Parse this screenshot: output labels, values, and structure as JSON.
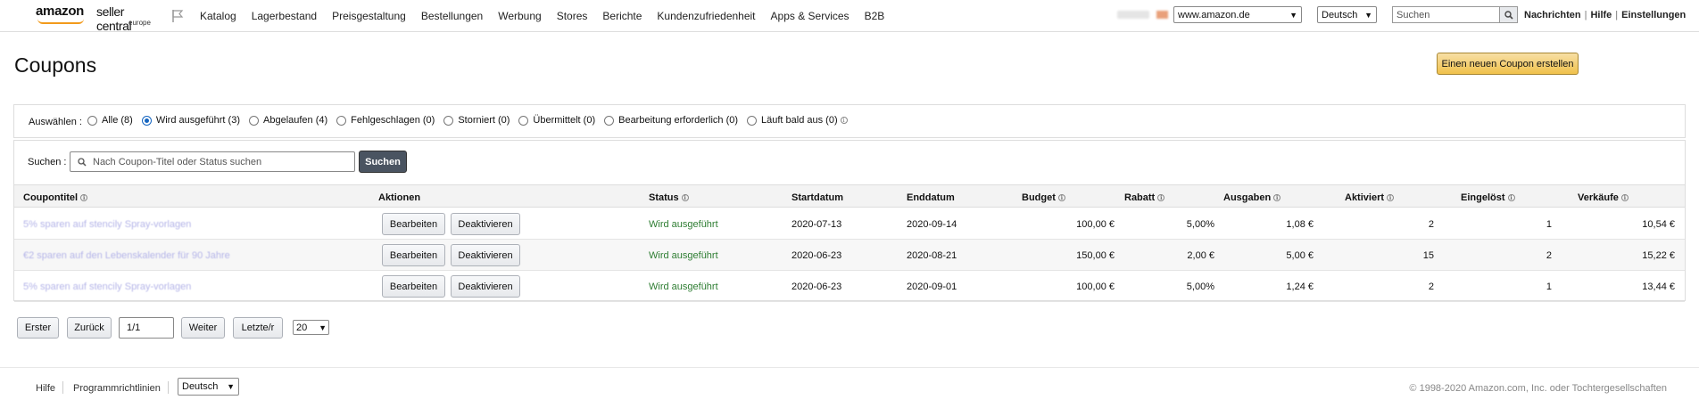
{
  "header": {
    "logo_amazon": "amazon",
    "logo_product": "seller central",
    "logo_region": "europe",
    "nav": [
      "Katalog",
      "Lagerbestand",
      "Preisgestaltung",
      "Bestellungen",
      "Werbung",
      "Stores",
      "Berichte",
      "Kundenzufriedenheit",
      "Apps & Services",
      "B2B"
    ],
    "marketplace": "www.amazon.de",
    "language": "Deutsch",
    "search_placeholder": "Suchen",
    "links": [
      "Nachrichten",
      "Hilfe",
      "Einstellungen"
    ]
  },
  "page": {
    "title": "Coupons",
    "create_button": "Einen neuen Coupon erstellen"
  },
  "filter": {
    "label": "Auswählen :",
    "options": [
      {
        "label": "Alle (8)",
        "selected": false
      },
      {
        "label": "Wird ausgeführt (3)",
        "selected": true
      },
      {
        "label": "Abgelaufen (4)",
        "selected": false
      },
      {
        "label": "Fehlgeschlagen (0)",
        "selected": false
      },
      {
        "label": "Storniert (0)",
        "selected": false
      },
      {
        "label": "Übermittelt (0)",
        "selected": false
      },
      {
        "label": "Bearbeitung erforderlich (0)",
        "selected": false
      },
      {
        "label": "Läuft bald aus (0)",
        "selected": false,
        "info": true
      }
    ]
  },
  "search": {
    "label": "Suchen :",
    "placeholder": "Nach Coupon-Titel oder Status suchen",
    "button": "Suchen"
  },
  "table": {
    "columns": [
      "Coupontitel",
      "Aktionen",
      "Status",
      "Startdatum",
      "Enddatum",
      "Budget",
      "Rabatt",
      "Ausgaben",
      "Aktiviert",
      "Eingelöst",
      "Verkäufe"
    ],
    "edit_label": "Bearbeiten",
    "deactivate_label": "Deaktivieren",
    "rows": [
      {
        "title": "5% sparen auf stencily Spray-vorlagen",
        "status": "Wird ausgeführt",
        "start": "2020-07-13",
        "end": "2020-09-14",
        "budget": "100,00 €",
        "rabatt": "5,00%",
        "ausgaben": "1,08 €",
        "aktiviert": "2",
        "eingeloest": "1",
        "verkaeufe": "10,54 €"
      },
      {
        "title": "€2 sparen auf den Lebenskalender für 90 Jahre",
        "status": "Wird ausgeführt",
        "start": "2020-06-23",
        "end": "2020-08-21",
        "budget": "150,00 €",
        "rabatt": "2,00 €",
        "ausgaben": "5,00 €",
        "aktiviert": "15",
        "eingeloest": "2",
        "verkaeufe": "15,22 €"
      },
      {
        "title": "5% sparen auf stencily Spray-vorlagen",
        "status": "Wird ausgeführt",
        "start": "2020-06-23",
        "end": "2020-09-01",
        "budget": "100,00 €",
        "rabatt": "5,00%",
        "ausgaben": "1,24 €",
        "aktiviert": "2",
        "eingeloest": "1",
        "verkaeufe": "13,44 €"
      }
    ]
  },
  "pager": {
    "first": "Erster",
    "prev": "Zurück",
    "page": "1/1",
    "next": "Weiter",
    "last": "Letzte/r",
    "page_size": "20"
  },
  "footer": {
    "help": "Hilfe",
    "policies": "Programmrichtlinien",
    "language": "Deutsch",
    "copyright": "© 1998-2020 Amazon.com, Inc. oder Tochtergesellschaften"
  },
  "colors": {
    "accent": "#f0c14b",
    "status_green": "#2e7d32",
    "radio_blue": "#1565c0"
  }
}
